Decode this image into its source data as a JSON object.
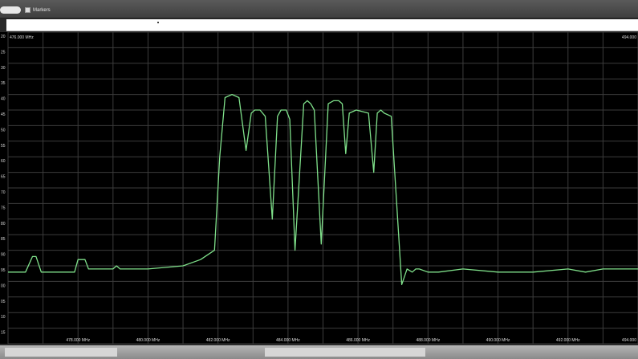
{
  "toolbar": {
    "markers_label": "Markers"
  },
  "plot": {
    "start_freq_label": "476.000 MHz",
    "stop_freq_label": "494.000",
    "y_ticks": [
      "20",
      "25",
      "30",
      "35",
      "40",
      "45",
      "50",
      "55",
      "60",
      "65",
      "70",
      "75",
      "80",
      "85",
      "90",
      "95",
      "00",
      "05",
      "10",
      "15"
    ],
    "x_ticks": [
      "478.000 MHz",
      "480.000 MHz",
      "482.000 MHz",
      "484.000 MHz",
      "486.000 MHz",
      "488.000 MHz",
      "490.000 MHz",
      "492.000 MHz",
      "494.000"
    ],
    "colors": {
      "trace": "#7fe08a",
      "grid": "#3c3c3c",
      "background": "#000000",
      "label": "#dddddd"
    }
  },
  "chart_data": {
    "type": "line",
    "x_unit": "MHz",
    "y_unit": "dB",
    "xlim": [
      476.0,
      494.0
    ],
    "ylim": [
      -117,
      -17
    ],
    "series": [
      {
        "x": [
          476.0,
          476.5,
          476.7,
          476.8,
          476.95,
          477.0,
          477.9,
          478.0,
          478.1,
          478.2,
          478.3,
          479.0,
          479.1,
          479.2,
          480.0,
          481.0,
          481.5,
          481.9,
          482.05,
          482.2,
          482.4,
          482.6,
          482.8,
          482.95,
          483.05,
          483.2,
          483.35,
          483.55,
          483.7,
          483.8,
          483.95,
          484.05,
          484.2,
          484.45,
          484.55,
          484.65,
          484.75,
          484.95,
          485.15,
          485.3,
          485.45,
          485.55,
          485.65,
          485.75,
          485.95,
          486.3,
          486.45,
          486.55,
          486.65,
          486.75,
          486.95,
          487.25,
          487.4,
          487.55,
          487.65,
          487.75,
          488.0,
          488.1,
          488.2,
          488.3,
          489.0,
          490.0,
          491.0,
          492.0,
          492.5,
          493.0,
          493.5,
          494.0
        ],
        "y": [
          -94,
          -94,
          -89,
          -89,
          -94,
          -94,
          -94,
          -90,
          -90,
          -90,
          -93,
          -93,
          -92,
          -93,
          -93,
          -92,
          -90,
          -87,
          -57,
          -38,
          -37,
          -38,
          -55,
          -43,
          -42,
          -42,
          -44,
          -77,
          -44,
          -42,
          -42,
          -45,
          -87,
          -40,
          -39,
          -40,
          -42,
          -85,
          -40,
          -39,
          -39,
          -40,
          -56,
          -43,
          -42,
          -43,
          -62,
          -43,
          -42,
          -43,
          -44,
          -98,
          -93,
          -94,
          -93,
          -93,
          -94,
          -94,
          -94,
          -94,
          -93,
          -94,
          -94,
          -93,
          -94,
          -93,
          -93,
          -93
        ],
        "source_points": "approximate"
      }
    ]
  }
}
